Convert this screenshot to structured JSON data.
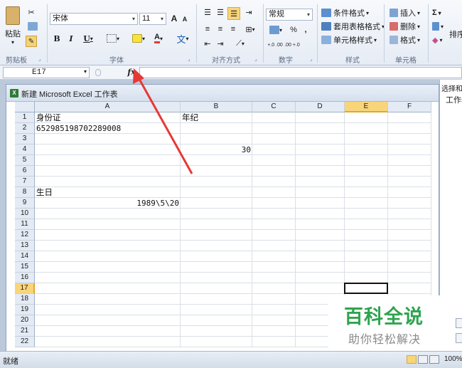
{
  "ribbon": {
    "clipboard": {
      "paste_label": "粘贴",
      "group_label": "剪贴板"
    },
    "font": {
      "family": "宋体",
      "size": "11",
      "grow": "A",
      "shrink": "A",
      "bold": "B",
      "italic": "I",
      "underline": "U",
      "wen": "文",
      "group_label": "字体"
    },
    "alignment": {
      "group_label": "对齐方式"
    },
    "number": {
      "format": "常规",
      "percent": "%",
      "comma": ",",
      "inc_decimal": "+.0 .00",
      "dec_decimal": ".00 +.0",
      "group_label": "数字"
    },
    "styles": {
      "conditional": "条件格式",
      "table_format": "套用表格格式",
      "cell_styles": "单元格样式",
      "group_label": "样式"
    },
    "cells": {
      "insert": "插入",
      "delete": "删除",
      "format": "格式",
      "group_label": "单元格"
    },
    "editing": {
      "sigma": "Σ",
      "sort": "排序"
    }
  },
  "formula_bar": {
    "name_box": "E17",
    "fx": "fx",
    "value": ""
  },
  "workbook": {
    "title": "新建 Microsoft Excel 工作表",
    "icon": "X",
    "columns": [
      "A",
      "B",
      "C",
      "D",
      "E",
      "F"
    ],
    "selected_column": "E",
    "rows": [
      "1",
      "2",
      "3",
      "4",
      "5",
      "6",
      "7",
      "8",
      "9",
      "10",
      "11",
      "12",
      "13",
      "14",
      "15",
      "16",
      "17",
      "18",
      "19",
      "20",
      "21",
      "22"
    ],
    "selected_row": "17",
    "cells": {
      "A1": "身份证",
      "B1": "年纪",
      "A2": "652985198702289008",
      "B4": "30",
      "A8": "生日",
      "A9": "1989\\5\\20"
    }
  },
  "side_pane": {
    "title": "选择和",
    "subtitle": "工作表"
  },
  "status_bar": {
    "text": "就绪",
    "zoom": "100%"
  },
  "watermark": {
    "title": "百科全说",
    "subtitle": "助你轻松解决"
  },
  "colors": {
    "watermark_green": "#2ea44f",
    "arrow_red": "#e53935",
    "selected_header": "#f9d57a"
  },
  "icons": [
    "paste-icon",
    "cut-icon",
    "copy-icon",
    "format-painter-icon",
    "border-icon",
    "fill-color-icon",
    "font-color-icon",
    "phonetic-icon",
    "align-icon",
    "wrap-icon",
    "merge-icon",
    "currency-icon",
    "conditional-format-icon",
    "table-style-icon",
    "cell-style-icon",
    "insert-icon",
    "delete-icon",
    "format-icon",
    "sum-icon",
    "fill-icon",
    "clear-icon",
    "fx-icon",
    "excel-icon"
  ]
}
